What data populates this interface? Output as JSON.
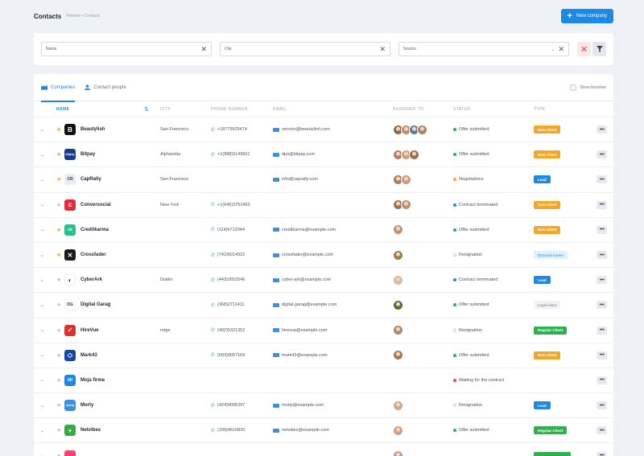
{
  "header": {
    "title": "Contacts",
    "breadcrumb": "Filmbee  •  Contacts",
    "new_company_label": "New company"
  },
  "filters": {
    "name_placeholder": "Name",
    "city_placeholder": "City",
    "source_placeholder": "Source"
  },
  "tabs": [
    {
      "label": "Companies",
      "active": true
    },
    {
      "label": "Contact people",
      "active": false
    }
  ],
  "show_favorites_label": "Show favorites",
  "columns": {
    "name": "NAME",
    "city": "CITY",
    "phone": "PHONE NUMBER",
    "email": "EMAIL",
    "assigned": "ASSIGNED TO",
    "status": "STATUS",
    "type": "TYPE"
  },
  "colors": {
    "accent": "#1e88e5",
    "new_client": "#f5a623",
    "lead": "#1e88e5",
    "regular_client": "#2bb24c",
    "status_green": "#2bb24c",
    "status_orange": "#f5a623",
    "status_blue": "#1e88e5",
    "status_red": "#f0435a",
    "status_grey": "#cfd4dc"
  },
  "rows": [
    {
      "name": "Beautylish",
      "favorite": true,
      "logo_color": "#111111",
      "logo_text": "B",
      "city": "San Francisco",
      "phone": "+18779925474",
      "email": "service@beautylish.com",
      "assignees": [
        "#8a6a4e",
        "#c58b66",
        "#5f7d98",
        "#a9846d"
      ],
      "status": "Offer submitted",
      "status_color": "#2bb24c",
      "type": "New Client",
      "type_style": "new"
    },
    {
      "name": "Bitpay",
      "favorite": true,
      "logo_color": "#1a3b8c",
      "logo_text": "bitpay",
      "city": "Alpharetta",
      "phone": "+1(888)9149661",
      "email": "dpo@bitpay.com",
      "assignees": [
        "#b07f5d",
        "#d29c78",
        "#9c6e52"
      ],
      "status": "Offer submitted",
      "status_color": "#2bb24c",
      "type": "New Client",
      "type_style": "new"
    },
    {
      "name": "CapRally",
      "favorite": true,
      "logo_color": "#e9ecf2",
      "logo_text": "CR",
      "city": "San Francisco",
      "phone": "",
      "email": "info@caprally.com",
      "assignees": [
        "#a77f58",
        "#c99a7d"
      ],
      "status": "Negotiations",
      "status_color": "#f5a623",
      "type": "Lead",
      "type_style": "lead"
    },
    {
      "name": "Conversocial",
      "favorite": false,
      "logo_color": "#e42b3c",
      "logo_text": "c",
      "city": "New York",
      "phone": "+1(646)3752492",
      "email": "",
      "assignees": [
        "#9a7451",
        "#c18f73"
      ],
      "status": "Contract terminated",
      "status_color": "#1e88e5",
      "type": "New Client",
      "type_style": "new"
    },
    {
      "name": "Creditkarma",
      "favorite": true,
      "logo_color": "#27c190",
      "logo_text": "ck",
      "city": "",
      "phone": "(114)6712044",
      "email": "creditkarma@example.com",
      "assignees": [
        "#c09075"
      ],
      "status": "Offer submitted",
      "status_color": "#2bb24c",
      "type": "New Client",
      "type_style": "new"
    },
    {
      "name": "Crossfader",
      "favorite": true,
      "logo_color": "#1c1c1c",
      "logo_text": "✕",
      "city": "",
      "phone": "(742)6014922",
      "email": "crossfader@example.com",
      "assignees": [
        "#9b7a52"
      ],
      "status": "Resignation",
      "status_color": "#cfd4dc",
      "type": "Discount hunter",
      "type_style": "discount"
    },
    {
      "name": "CyberArk",
      "favorite": false,
      "logo_color": "#ffffff",
      "logo_text": "◐",
      "city": "Dublin",
      "phone": "(443)2652546",
      "email": "cyber-ark@example.com",
      "assignees": [
        "#d8b7a2"
      ],
      "status": "Contract terminated",
      "status_color": "#1e88e5",
      "type": "Lead",
      "type_style": "lead"
    },
    {
      "name": "Digital Garag",
      "favorite": false,
      "logo_color": "#ffffff",
      "logo_text": "DG",
      "city": "",
      "phone": "(368)2711411",
      "email": "digital.garag@example.com",
      "assignees": [
        "#4f6f3c"
      ],
      "status": "Offer submitted",
      "status_color": "#2bb24c",
      "type": "Loyal client",
      "type_style": "loyal"
    },
    {
      "name": "HireVue",
      "favorite": false,
      "logo_color": "#e02f2f",
      "logo_text": "✓",
      "city": "retge",
      "phone": "(492)5321352",
      "email": "hirevue@example.com",
      "assignees": [
        "#a8896a"
      ],
      "status": "Resignation",
      "status_color": "#cfd4dc",
      "type": "Regular Client",
      "type_style": "regular"
    },
    {
      "name": "Mark43",
      "favorite": false,
      "logo_color": "#1747a6",
      "logo_text": "◇",
      "city": "",
      "phone": "(693)9057169",
      "email": "mark43@example.com",
      "assignees": [
        "#9e7d58"
      ],
      "status": "Offer submitted",
      "status_color": "#2bb24c",
      "type": "New Client",
      "type_style": "new"
    },
    {
      "name": "Moja firma",
      "favorite": false,
      "logo_color": "#1e88e5",
      "logo_text": "Mf",
      "city": "",
      "phone": "",
      "email": "",
      "assignees": [],
      "status": "Waiting for the contract",
      "status_color": "#f0435a",
      "type": "",
      "type_style": "none"
    },
    {
      "name": "Morty",
      "favorite": false,
      "logo_color": "#3d8fe0",
      "logo_text": "morty",
      "city": "",
      "phone": "(424)9095297",
      "email": "morty@example.com",
      "assignees": [
        "#d0a58a"
      ],
      "status": "Resignation",
      "status_color": "#cfd4dc",
      "type": "Lead",
      "type_style": "lead"
    },
    {
      "name": "Netvibes",
      "favorite": false,
      "logo_color": "#3aa846",
      "logo_text": "+",
      "city": "",
      "phone": "(339)4610820",
      "email": "netvibes@example.com",
      "assignees": [
        "#c9a087"
      ],
      "status": "Offer submitted",
      "status_color": "#2bb24c",
      "type": "Regular Client",
      "type_style": "regular"
    },
    {
      "name": "",
      "favorite": false,
      "logo_color": "#f0437a",
      "logo_text": "",
      "city": "",
      "phone": "",
      "email": "",
      "assignees": [
        "#c39a80"
      ],
      "status": "",
      "status_color": "#2bb24c",
      "type": "",
      "type_style": "regular-partial"
    }
  ]
}
